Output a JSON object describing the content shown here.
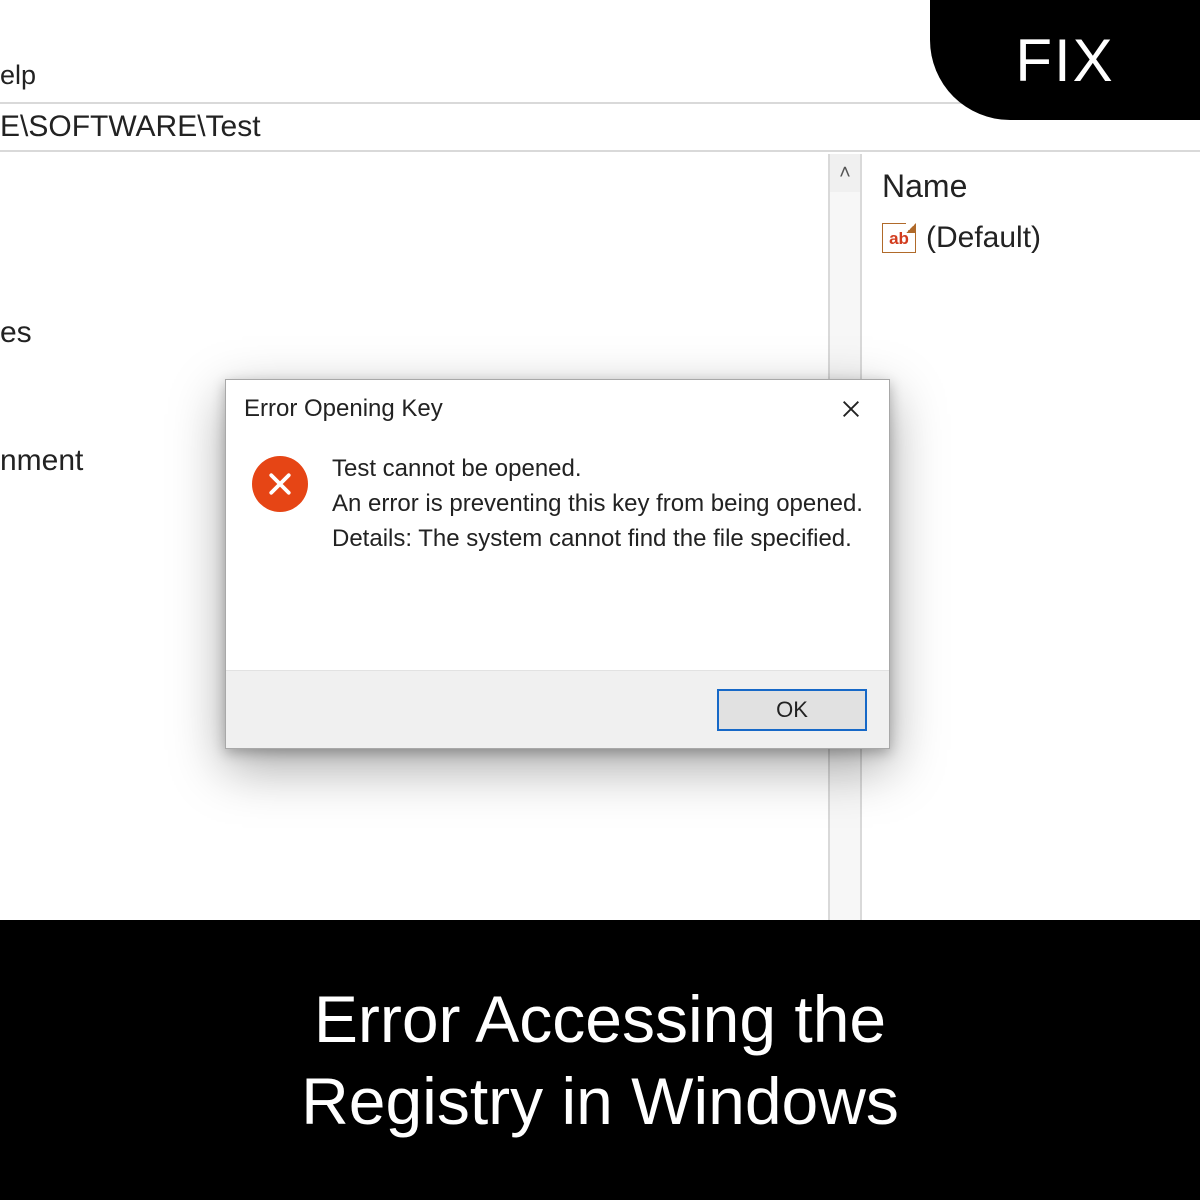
{
  "menu": {
    "help": "elp"
  },
  "address": {
    "path": "E\\SOFTWARE\\Test"
  },
  "tree": {
    "items": [
      "es",
      "nment"
    ]
  },
  "scrollbar": {
    "up_glyph": "˄"
  },
  "values": {
    "header_name": "Name",
    "default_label": "(Default)",
    "string_icon_text": "ab"
  },
  "badge": {
    "fix": "FIX"
  },
  "dialog": {
    "title": "Error Opening Key",
    "line1": "Test cannot be opened.",
    "line2": "An error is preventing this key from being opened.",
    "line3": "Details: The system cannot find the file specified.",
    "ok": "OK"
  },
  "caption": {
    "line1": "Error Accessing the",
    "line2": "Registry in Windows"
  }
}
